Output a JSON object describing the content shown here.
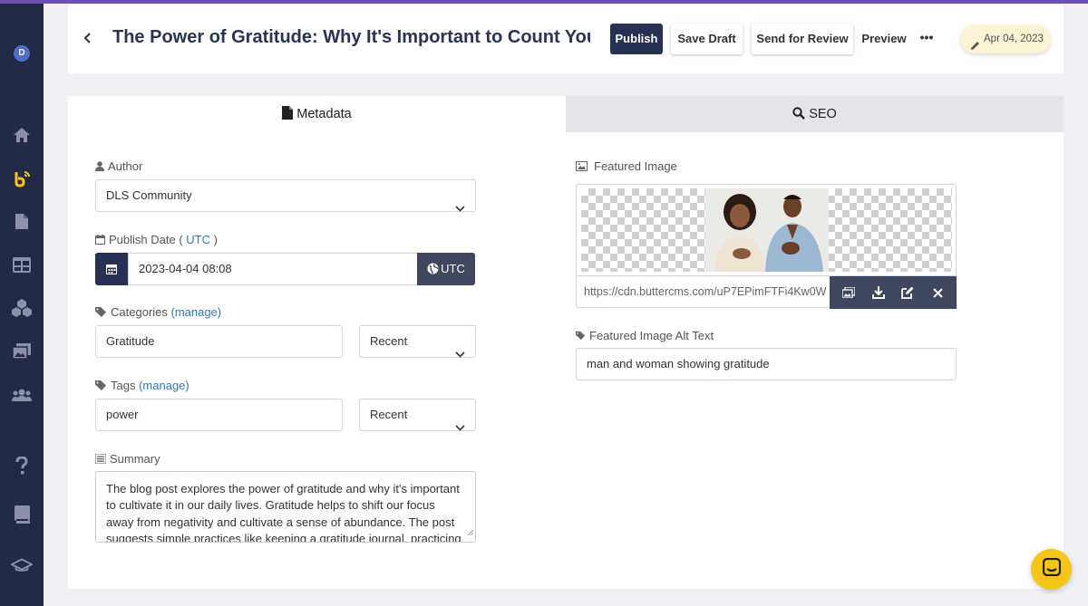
{
  "app": {
    "accent": "#6c4fb5",
    "sidebar_bg": "#222a45"
  },
  "sidebar": {
    "avatar_initial": "D",
    "items": [
      {
        "icon": "home-icon"
      },
      {
        "icon": "buttercms-logo-icon"
      },
      {
        "icon": "page-icon"
      },
      {
        "icon": "content-table-icon"
      },
      {
        "icon": "components-icon"
      },
      {
        "icon": "media-library-icon"
      },
      {
        "icon": "users-icon"
      },
      {
        "icon": "help-icon"
      },
      {
        "icon": "docs-book-icon"
      },
      {
        "icon": "graduation-cap-icon"
      }
    ]
  },
  "header": {
    "title": "The Power of Gratitude: Why It's Important to Count Your Blessings",
    "publish_label": "Publish",
    "save_draft_label": "Save Draft",
    "send_review_label": "Send for Review",
    "preview_label": "Preview",
    "more_label": "•••",
    "date": "Apr 04, 2023"
  },
  "tabs": {
    "metadata": "Metadata",
    "seo": "SEO"
  },
  "author": {
    "label": "Author",
    "value": "DLS Community"
  },
  "publish_date": {
    "label": "Publish Date (",
    "tz_link": "UTC",
    "label_end": ")",
    "value": "2023-04-04 08:08",
    "tz_button": "UTC"
  },
  "categories": {
    "label": "Categories",
    "manage": "(manage)",
    "value": "Gratitude",
    "sort": "Recent"
  },
  "tags": {
    "label": "Tags",
    "manage": "(manage)",
    "value": "power",
    "sort": "Recent"
  },
  "summary": {
    "label": "Summary",
    "text": "The blog post explores the power of gratitude and why it's important to cultivate it in our daily lives. Gratitude helps to shift our focus away from negativity and cultivate a sense of abundance. The post suggests simple practices like keeping a gratitude journal, practicing gratitude"
  },
  "featured_image": {
    "label": "Featured Image",
    "url": "https://cdn.buttercms.com/uP7EPimFTFi4Kw0W"
  },
  "alt_text": {
    "label": "Featured Image Alt Text",
    "value": "man and woman showing gratitude"
  }
}
